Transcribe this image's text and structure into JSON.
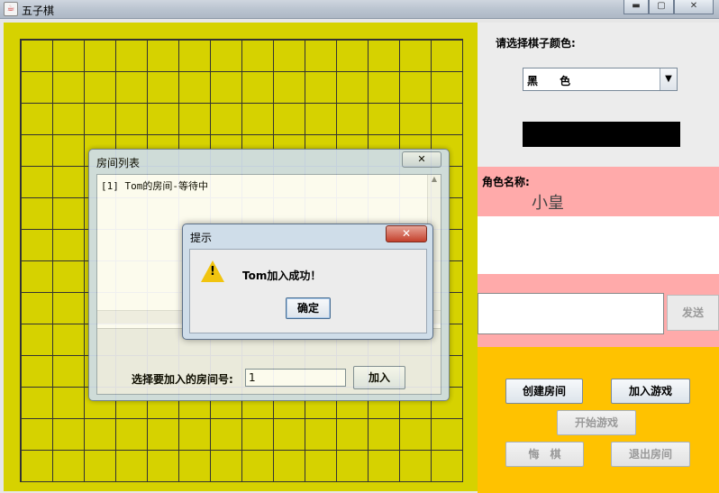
{
  "window": {
    "title": "五子棋",
    "app_icon": "java-cup-icon",
    "minimize_label": "▬",
    "maximize_label": "▢",
    "close_label": "✕"
  },
  "board": {
    "background": "#d6d200",
    "line_color": "#333333"
  },
  "side": {
    "color_label": "请选择棋子颜色:",
    "color_selected": "黑 色",
    "color_swatch": "#000000",
    "role_label": "角色名称:",
    "role_name": "小皇",
    "message_input": "",
    "send_label": "发送",
    "buttons": {
      "create_room": "创建房间",
      "join_game": "加入游戏",
      "start_game": "开始游戏",
      "undo": "悔　棋",
      "leave_room": "退出房间"
    }
  },
  "room_dialog": {
    "title": "房间列表",
    "close_label": "✕",
    "rooms": [
      "[1] Tom的房间-等待中"
    ],
    "join_label": "选择要加入的房间号:",
    "room_number": "1",
    "join_button": "加入"
  },
  "prompt_dialog": {
    "title": "提示",
    "close_label": "✕",
    "message": "Tom加入成功！",
    "ok_label": "确定"
  }
}
